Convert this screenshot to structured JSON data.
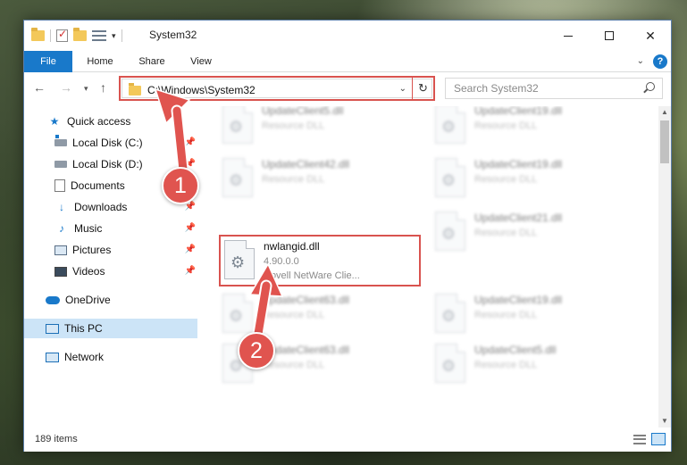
{
  "window": {
    "title": "System32"
  },
  "ribbon": {
    "tabs": [
      {
        "label": "File"
      },
      {
        "label": "Home"
      },
      {
        "label": "Share"
      },
      {
        "label": "View"
      }
    ],
    "help": "?"
  },
  "navigation": {
    "address": "C:\\Windows\\System32",
    "search_placeholder": "Search System32"
  },
  "sidebar": {
    "items": [
      {
        "label": "Quick access",
        "icon": "star-icon"
      },
      {
        "label": "Local Disk (C:)",
        "icon": "drive-icon"
      },
      {
        "label": "Local Disk (D:)",
        "icon": "drive-icon"
      },
      {
        "label": "Documents",
        "icon": "documents-icon"
      },
      {
        "label": "Downloads",
        "icon": "download-icon"
      },
      {
        "label": "Music",
        "icon": "music-icon"
      },
      {
        "label": "Pictures",
        "icon": "pictures-icon"
      },
      {
        "label": "Videos",
        "icon": "videos-icon"
      },
      {
        "label": "OneDrive",
        "icon": "cloud-icon"
      },
      {
        "label": "This PC",
        "icon": "computer-icon"
      },
      {
        "label": "Network",
        "icon": "network-icon"
      }
    ]
  },
  "files": [
    {
      "name": "UpdateClient5.dll",
      "type": "Resource DLL"
    },
    {
      "name": "UpdateClient19.dll",
      "type": "Resource DLL"
    },
    {
      "name": "UpdateClient42.dll",
      "type": "Resource DLL"
    },
    {
      "name": "UpdateClient19.dll",
      "type": "Resource DLL"
    },
    {
      "name": "nwlangid.dll",
      "version": "4.90.0.0",
      "description": "Novell NetWare Clie..."
    },
    {
      "name": "UpdateClient21.dll",
      "type": "Resource DLL"
    },
    {
      "name": "UpdateClient63.dll",
      "type": "Resource DLL"
    },
    {
      "name": "UpdateClient19.dll",
      "type": "Resource DLL"
    },
    {
      "name": "UpdateClient63.dll",
      "type": "Resource DLL"
    },
    {
      "name": "UpdateClient5.dll",
      "type": "Resource DLL"
    }
  ],
  "status": {
    "item_count": "189 items"
  },
  "annotations": {
    "step1": "1",
    "step2": "2"
  },
  "colors": {
    "accent": "#1979ca",
    "highlight": "#d9534f",
    "badge": "#e0544f"
  }
}
